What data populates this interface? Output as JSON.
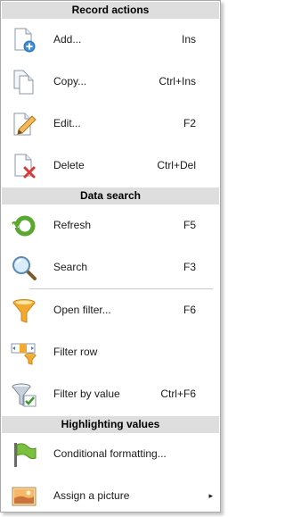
{
  "sections": [
    {
      "title": "Record actions",
      "items": [
        {
          "label": "Add...",
          "shortcut": "Ins",
          "icon": "add-document-icon"
        },
        {
          "label": "Copy...",
          "shortcut": "Ctrl+Ins",
          "icon": "copy-document-icon"
        },
        {
          "label": "Edit...",
          "shortcut": "F2",
          "icon": "edit-pencil-icon"
        },
        {
          "label": "Delete",
          "shortcut": "Ctrl+Del",
          "icon": "delete-document-icon"
        }
      ]
    },
    {
      "title": "Data search",
      "items": [
        {
          "label": "Refresh",
          "shortcut": "F5",
          "icon": "refresh-icon"
        },
        {
          "label": "Search",
          "shortcut": "F3",
          "icon": "magnifier-icon"
        },
        {
          "label": "Open filter...",
          "shortcut": "F6",
          "icon": "funnel-icon"
        },
        {
          "label": "Filter row",
          "shortcut": "",
          "icon": "filter-row-icon"
        },
        {
          "label": "Filter by value",
          "shortcut": "Ctrl+F6",
          "icon": "filter-by-value-icon"
        }
      ]
    },
    {
      "title": "Highlighting values",
      "items": [
        {
          "label": "Conditional formatting...",
          "shortcut": "",
          "icon": "green-flag-icon"
        },
        {
          "label": "Assign a picture",
          "shortcut": "",
          "icon": "picture-icon",
          "submenu_arrow": "▸"
        }
      ]
    }
  ]
}
